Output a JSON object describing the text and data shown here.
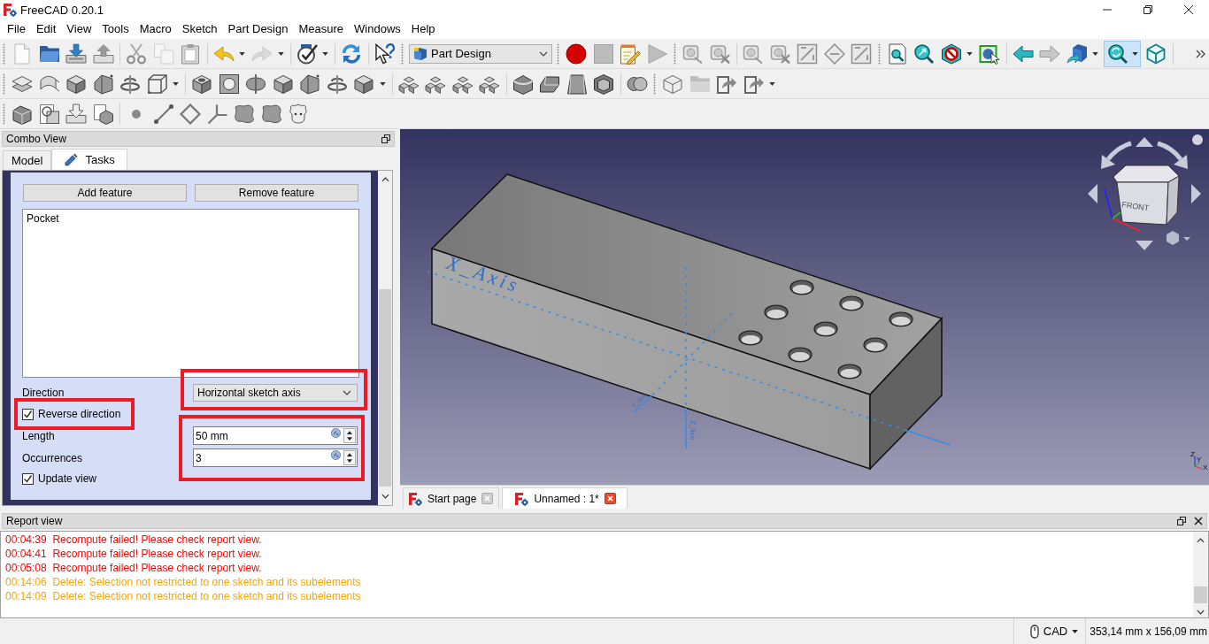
{
  "window": {
    "title": "FreeCAD 0.20.1"
  },
  "menu": [
    "File",
    "Edit",
    "View",
    "Tools",
    "Macro",
    "Sketch",
    "Part Design",
    "Measure",
    "Windows",
    "Help"
  ],
  "toolbar": {
    "workbench": "Part Design",
    "sync_view_on": true
  },
  "combo_view": {
    "title": "Combo View",
    "tabs": [
      {
        "label": "Model",
        "kind": "plain",
        "selected": false
      },
      {
        "label": "Tasks",
        "kind": "task",
        "selected": true
      }
    ],
    "task_panel": {
      "buttons": [
        "Add feature",
        "Remove feature"
      ],
      "features": [
        "Pocket"
      ],
      "direction": {
        "label": "Direction",
        "value": "Horizontal sketch axis",
        "highlighted": true
      },
      "reverse_direction": {
        "label": "Reverse direction",
        "checked": true,
        "highlighted": true
      },
      "length": {
        "label": "Length",
        "value": "50 mm"
      },
      "occurrences": {
        "label": "Occurrences",
        "value": "3"
      },
      "values_highlighted": true,
      "update_view": {
        "label": "Update view",
        "checked": true
      }
    }
  },
  "view": {
    "axis_labels": [
      "X_Axis",
      "Y_Axis",
      "Z_Axis"
    ],
    "cube_face": "FRONT",
    "axis_cross": [
      "Z",
      "Y",
      "X"
    ]
  },
  "document_tabs": [
    {
      "label": "Start page",
      "selected": false
    },
    {
      "label": "Unnamed : 1*",
      "selected": true
    }
  ],
  "report_view": {
    "title": "Report view",
    "lines": [
      {
        "time": "00:04:39",
        "message": "Recompute failed! Please check report view.",
        "kind": "error"
      },
      {
        "time": "00:04:41",
        "message": "Recompute failed! Please check report view.",
        "kind": "error"
      },
      {
        "time": "00:05:08",
        "message": "Recompute failed! Please check report view.",
        "kind": "error"
      },
      {
        "time": "00:14:06",
        "message": "Delete: Selection not restricted to one sketch and its subelements",
        "kind": "warning"
      },
      {
        "time": "00:14:09",
        "message": "Delete: Selection not restricted to one sketch and its subelements",
        "kind": "warning"
      }
    ]
  },
  "status_bar": {
    "navigation": "CAD",
    "dimensions": "353,14 mm x 156,09 mm"
  }
}
